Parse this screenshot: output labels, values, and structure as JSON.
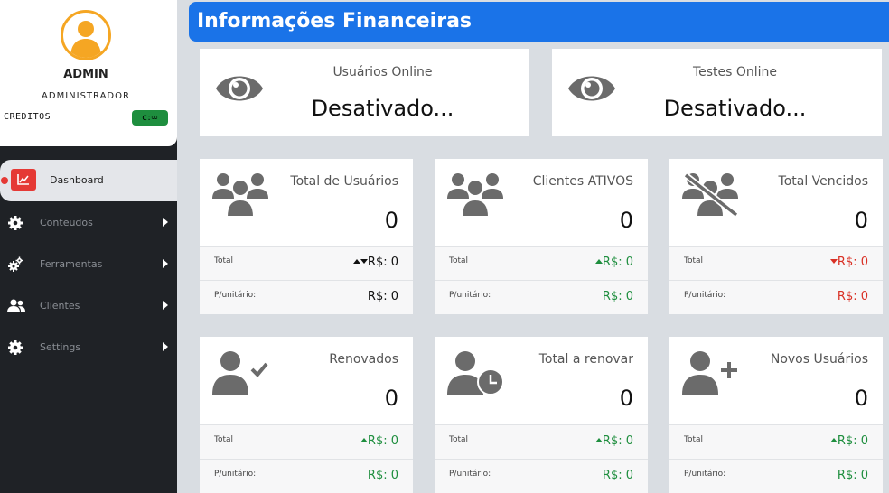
{
  "profile": {
    "name": "ADMIN",
    "role": "ADMINISTRADOR",
    "credits_label": "CREDITOS",
    "credits_value": "¢:∞"
  },
  "nav": {
    "active": "Dashboard",
    "items": [
      {
        "label": "Conteudos",
        "icon": "gear-icon"
      },
      {
        "label": "Ferramentas",
        "icon": "gears-icon"
      },
      {
        "label": "Clientes",
        "icon": "users-icon"
      },
      {
        "label": "Settings",
        "icon": "gear-icon"
      }
    ]
  },
  "header": {
    "title": "Informações Financeiras"
  },
  "online": {
    "users_title": "Usuários Online",
    "users_value": "Desativado...",
    "tests_title": "Testes Online",
    "tests_value": "Desativado..."
  },
  "stats": [
    {
      "title": "Total de Usuários",
      "value": "0",
      "total_label": "Total",
      "total_value": "R$: 0",
      "unit_label": "P/unitário:",
      "unit_value": "R$: 0",
      "icon": "users-group-icon"
    },
    {
      "title": "Clientes ATIVOS",
      "value": "0",
      "total_label": "Total",
      "total_value": "R$: 0",
      "unit_label": "P/unitário:",
      "unit_value": "R$: 0",
      "icon": "users-group-icon"
    },
    {
      "title": "Total Vencidos",
      "value": "0",
      "total_label": "Total",
      "total_value": "R$: 0",
      "unit_label": "P/unitário:",
      "unit_value": "R$: 0",
      "icon": "users-slash-icon"
    },
    {
      "title": "Renovados",
      "value": "0",
      "total_label": "Total",
      "total_value": "R$: 0",
      "unit_label": "P/unitário:",
      "unit_value": "R$: 0",
      "icon": "user-check-icon"
    },
    {
      "title": "Total a renovar",
      "value": "0",
      "total_label": "Total",
      "total_value": "R$: 0",
      "unit_label": "P/unitário:",
      "unit_value": "R$: 0",
      "icon": "user-clock-icon"
    },
    {
      "title": "Novos Usuários",
      "value": "0",
      "total_label": "Total",
      "total_value": "R$: 0",
      "unit_label": "P/unitário:",
      "unit_value": "R$: 0",
      "icon": "user-plus-icon"
    }
  ],
  "colors": {
    "header": "#1a73e8",
    "sidebar": "#1f2226",
    "positive": "#1e8e3e",
    "negative": "#d93025",
    "avatar_ring": "#f5a623"
  }
}
